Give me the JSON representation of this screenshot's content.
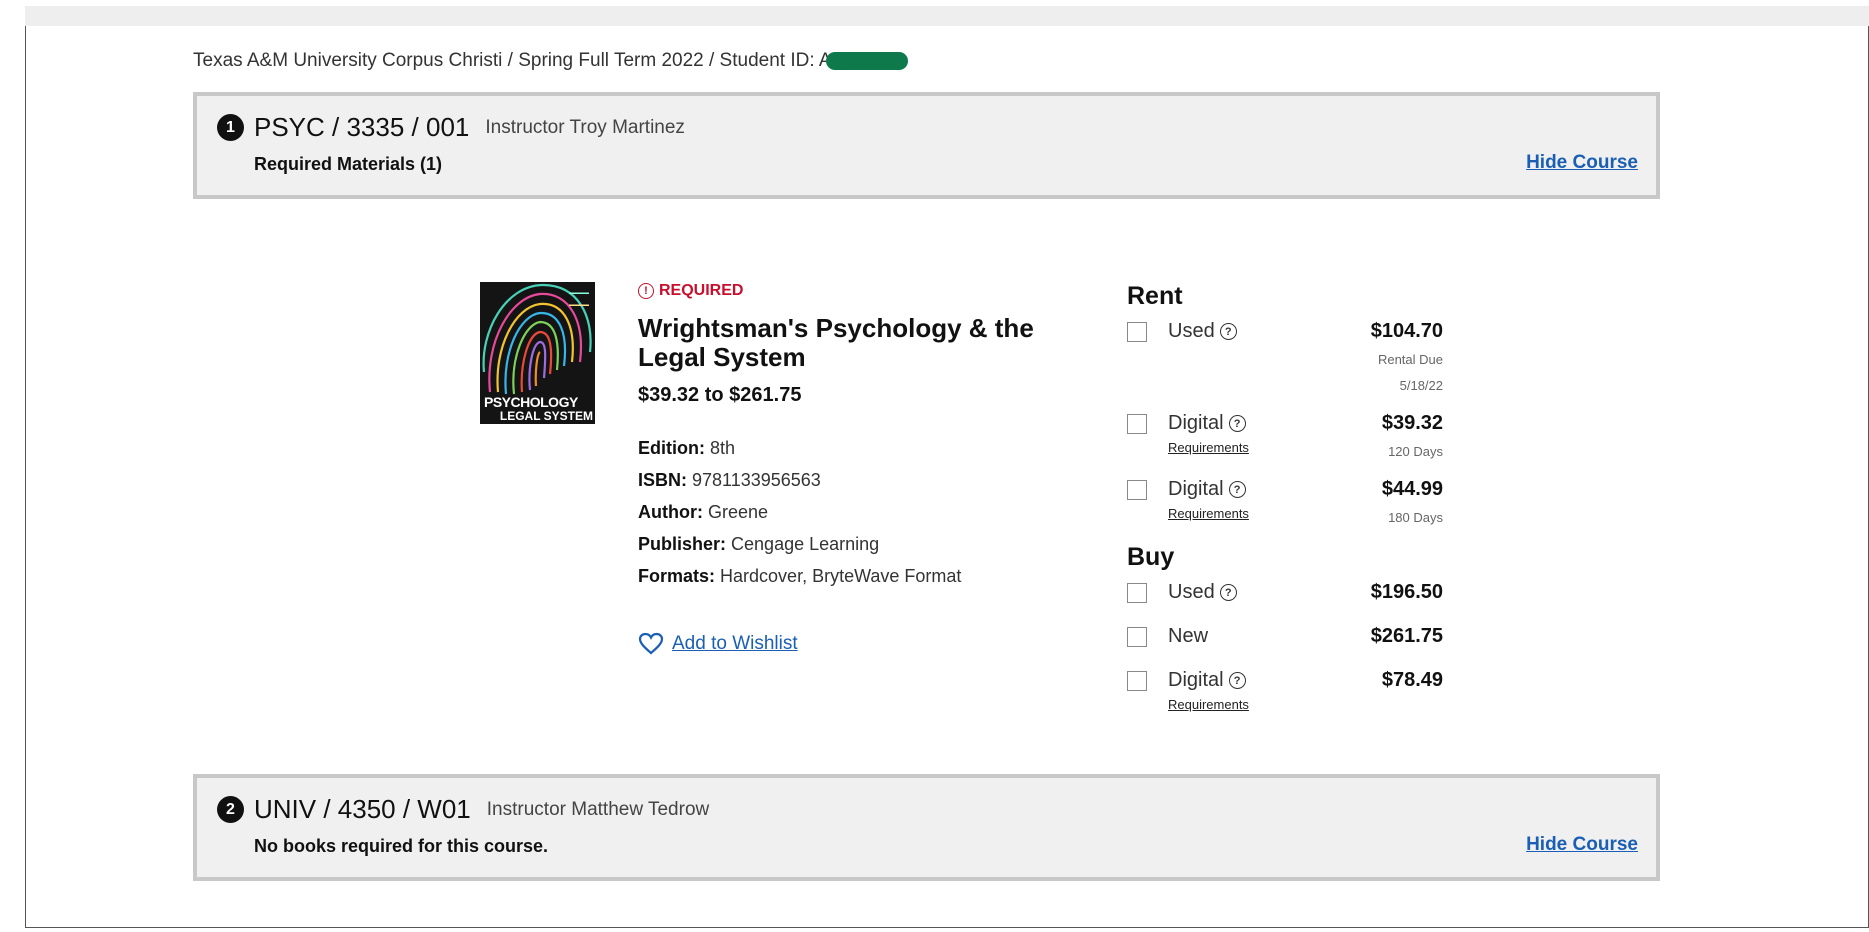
{
  "breadcrumb": "Texas A&M University Corpus Christi / Spring Full Term 2022 / Student ID: A",
  "courses": [
    {
      "number": "1",
      "code": "PSYC / 3335 / 001",
      "instructor": "Instructor Troy Martinez",
      "subtitle": "Required Materials (1)",
      "hide_label": "Hide Course"
    },
    {
      "number": "2",
      "code": "UNIV / 4350 / W01",
      "instructor": "Instructor Matthew Tedrow",
      "subtitle": "No books required for this course.",
      "hide_label": "Hide Course"
    }
  ],
  "book": {
    "cover_text_top": "PSYCHOLOGY",
    "cover_text_bottom": "LEGAL SYSTEM",
    "required_label": "REQUIRED",
    "title": "Wrightsman's Psychology & the Legal System",
    "price_range": "$39.32 to $261.75",
    "details": [
      {
        "label": "Edition:",
        "value": "8th"
      },
      {
        "label": "ISBN:",
        "value": "9781133956563"
      },
      {
        "label": "Author:",
        "value": "Greene"
      },
      {
        "label": "Publisher:",
        "value": "Cengage Learning"
      },
      {
        "label": "Formats:",
        "value": "Hardcover, BryteWave Format"
      }
    ],
    "wishlist_label": "Add to Wishlist"
  },
  "rent": {
    "heading": "Rent",
    "options": [
      {
        "label": "Used",
        "price": "$104.70",
        "note1": "Rental Due",
        "note2": "5/18/22"
      },
      {
        "label": "Digital",
        "price": "$39.32",
        "requirements": "Requirements",
        "note1": "120 Days"
      },
      {
        "label": "Digital",
        "price": "$44.99",
        "requirements": "Requirements",
        "note1": "180 Days"
      }
    ]
  },
  "buy": {
    "heading": "Buy",
    "options": [
      {
        "label": "Used",
        "price": "$196.50"
      },
      {
        "label": "New",
        "price": "$261.75"
      },
      {
        "label": "Digital",
        "price": "$78.49",
        "requirements": "Requirements"
      }
    ]
  },
  "colors": {
    "required": "#c8102e",
    "link": "#1a5fb4",
    "redaction": "#0e7a4b"
  }
}
